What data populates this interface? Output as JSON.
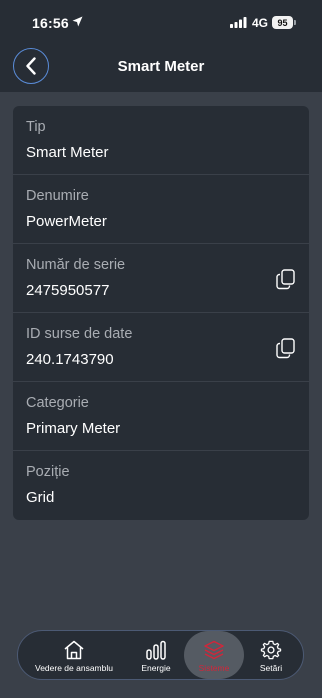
{
  "status_bar": {
    "time": "16:56",
    "network": "4G",
    "battery": "95"
  },
  "header": {
    "title": "Smart Meter",
    "back_icon": "chevron-left-icon"
  },
  "details": [
    {
      "label": "Tip",
      "value": "Smart Meter",
      "copyable": false
    },
    {
      "label": "Denumire",
      "value": "PowerMeter",
      "copyable": false
    },
    {
      "label": "Număr de serie",
      "value": "2475950577",
      "copyable": true
    },
    {
      "label": "ID surse de date",
      "value": "240.1743790",
      "copyable": true
    },
    {
      "label": "Categorie",
      "value": "Primary Meter",
      "copyable": false
    },
    {
      "label": "Poziție",
      "value": "Grid",
      "copyable": false
    }
  ],
  "nav": {
    "items": [
      {
        "label": "Vedere de ansamblu",
        "icon": "home-icon",
        "active": false
      },
      {
        "label": "Energie",
        "icon": "bar-chart-icon",
        "active": false
      },
      {
        "label": "Sisteme",
        "icon": "layers-icon",
        "active": true
      },
      {
        "label": "Setări",
        "icon": "gear-icon",
        "active": false
      }
    ]
  },
  "colors": {
    "background": "#3a4049",
    "surface": "#272d35",
    "accent": "#5a8cd8",
    "active": "#d2263a"
  }
}
